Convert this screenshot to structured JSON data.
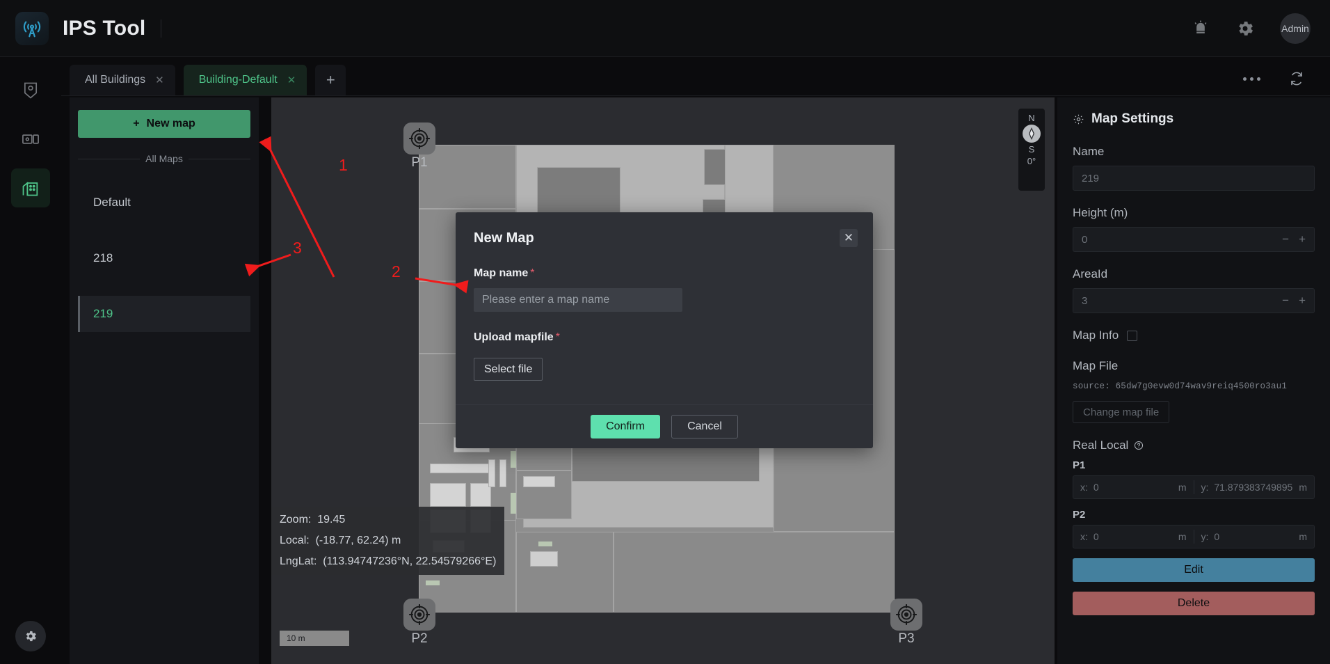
{
  "header": {
    "app_title": "IPS Tool",
    "logo_icon": "wifi-tower-icon",
    "alarm_icon": "alarm-bell-icon",
    "gear_icon": "gear-icon",
    "user_label": "Admin"
  },
  "rail": {
    "items": [
      {
        "name": "location-pin",
        "icon": "location-pin-icon",
        "active": false
      },
      {
        "name": "devices",
        "icon": "device-monitor-icon",
        "active": false
      },
      {
        "name": "buildings",
        "icon": "building-icon",
        "active": true
      }
    ],
    "settings_icon": "gear-icon"
  },
  "tabs": {
    "items": [
      {
        "label": "All Buildings",
        "active": false,
        "close_icon": "close-icon"
      },
      {
        "label": "Building-Default",
        "active": true,
        "close_icon": "close-icon"
      }
    ],
    "add_label": "+",
    "more_icon": "more-horizontal-icon",
    "refresh_icon": "refresh-icon"
  },
  "maplist": {
    "new_map_label": "New map",
    "new_map_icon": "plus-icon",
    "group_label": "All Maps",
    "items": [
      {
        "label": "Default",
        "selected": false
      },
      {
        "label": "218",
        "selected": false
      },
      {
        "label": "219",
        "selected": true
      }
    ]
  },
  "map": {
    "compass": {
      "north": "N",
      "south": "S",
      "bearing": "0°",
      "needle_icon": "compass-needle-icon"
    },
    "info": {
      "zoom_label": "Zoom:",
      "zoom_value": "19.45",
      "local_label": "Local:",
      "local_value": "(-18.77, 62.24) m",
      "lnglat_label": "LngLat:",
      "lnglat_value": "(113.94747236°N, 22.54579266°E)"
    },
    "scale_label": "10 m",
    "anchors": [
      {
        "label": "P1",
        "icon": "crosshair-target-icon"
      },
      {
        "label": "P2",
        "icon": "crosshair-target-icon"
      },
      {
        "label": "P3",
        "icon": "crosshair-target-icon"
      }
    ]
  },
  "dialog": {
    "title": "New Map",
    "close_icon": "close-icon",
    "map_name_label": "Map name",
    "map_name_required": "*",
    "map_name_value": "",
    "map_name_placeholder": "Please enter a map name",
    "upload_label": "Upload mapfile",
    "upload_required": "*",
    "select_file_label": "Select file",
    "confirm_label": "Confirm",
    "cancel_label": "Cancel"
  },
  "settings": {
    "panel_title": "Map Settings",
    "panel_icon": "gear-icon",
    "name_label": "Name",
    "name_value": "219",
    "height_label": "Height (m)",
    "height_value": "0",
    "minus_icon": "minus-icon",
    "plus_icon": "plus-icon",
    "areaid_label": "AreaId",
    "areaid_value": "3",
    "mapinfo_label": "Map Info",
    "mapinfo_checked": false,
    "mapfile_label": "Map File",
    "source_text": "source: 65dw7g0evw0d74wav9reiq4500ro3au1",
    "change_file_label": "Change map file",
    "real_local_label": "Real Local",
    "help_icon": "question-circle-icon",
    "points": [
      {
        "tag": "P1",
        "x_key": "x:",
        "x_value": "0",
        "x_unit": "m",
        "y_key": "y:",
        "y_value": "71.879383749895",
        "y_unit": "m"
      },
      {
        "tag": "P2",
        "x_key": "x:",
        "x_value": "0",
        "x_unit": "m",
        "y_key": "y:",
        "y_value": "0",
        "y_unit": "m"
      }
    ],
    "edit_label": "Edit",
    "delete_label": "Delete"
  },
  "annotations": {
    "color": "#f01c1c",
    "markers": [
      {
        "label": "1"
      },
      {
        "label": "2"
      },
      {
        "label": "3"
      }
    ]
  }
}
